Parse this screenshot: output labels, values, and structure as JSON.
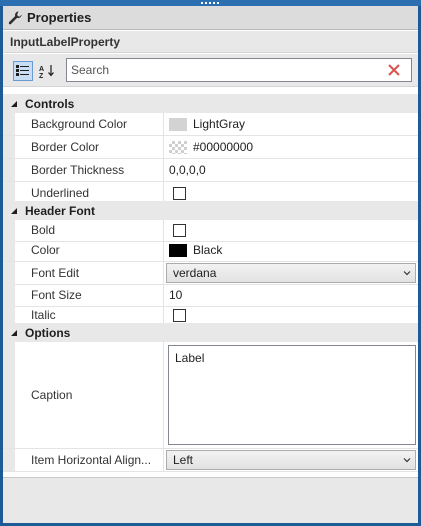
{
  "window": {
    "title": "Properties",
    "object_name": "InputLabelProperty"
  },
  "toolbar": {
    "search_placeholder": "Search",
    "categorized_icon": "categorized-view-icon",
    "alpha_icon": "alphabetical-sort-icon"
  },
  "categories": {
    "controls": {
      "label": "Controls",
      "rows": {
        "background_color": {
          "name": "Background Color",
          "value": "LightGray",
          "swatch": "#d3d3d3"
        },
        "border_color": {
          "name": "Border Color",
          "value": "#00000000",
          "swatch": "transparent"
        },
        "border_thickness": {
          "name": "Border Thickness",
          "value": "0,0,0,0"
        },
        "underlined": {
          "name": "Underlined",
          "checked": false
        }
      }
    },
    "header_font": {
      "label": "Header Font",
      "rows": {
        "bold": {
          "name": "Bold",
          "checked": false
        },
        "color": {
          "name": "Color",
          "value": "Black",
          "swatch": "#000000"
        },
        "font_edit": {
          "name": "Font Edit",
          "value": "verdana"
        },
        "font_size": {
          "name": "Font Size",
          "value": "10"
        },
        "italic": {
          "name": "Italic",
          "checked": false
        }
      }
    },
    "options": {
      "label": "Options",
      "rows": {
        "caption": {
          "name": "Caption",
          "value": "Label"
        },
        "item_horizontal_alignment": {
          "name": "Item Horizontal Align...",
          "value": "Left"
        }
      }
    }
  },
  "colors": {
    "frame": "#1c5b96",
    "panel_gray": "#e8e8e8"
  }
}
